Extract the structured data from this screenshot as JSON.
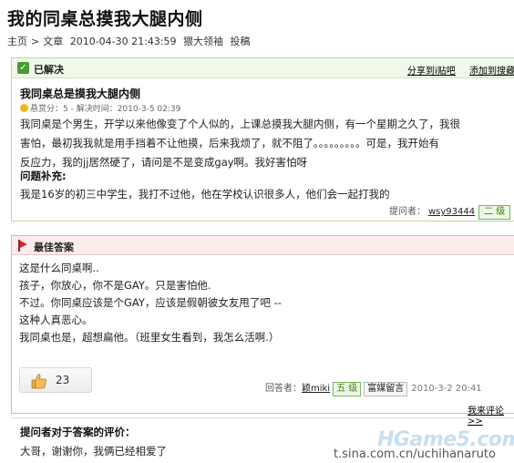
{
  "page": {
    "title": "我的同桌总摸我大腿内侧",
    "meta": {
      "breadcrumb_home": "主页",
      "breadcrumb_sep": ">",
      "breadcrumb_article": "文章",
      "timestamp": "2010-04-30 21:43:59",
      "author": "猥大领袖",
      "action": "投稿"
    }
  },
  "question": {
    "status_icon": "check-icon",
    "status": "已解决",
    "share_label": "分享到i贴吧",
    "fav_label": "添加到搜藏",
    "title": "我同桌总是摸我大腿内侧",
    "reward": "悬赏分：5 - 解决时间：2010-3-5 02:39",
    "body_lines": [
      "我同桌是个男生，开学以来他像变了个人似的，上课总摸我大腿内侧，有一个星期之久了，我很",
      "害怕，最初我我就是用手挡着不让他摸，后来我烦了，就不阻了。。。。。。。。。可是，我开始有",
      "反应力，我的jj居然硬了，请问是不是变成gay啊。我好害怕呀"
    ],
    "supplement_title": "问题补充:",
    "supplement": "我是16岁的初三中学生，我打不过他，他在学校认识很多人，他们会一起打我的",
    "asker_label": "提问者：",
    "asker_name": "wsy93444",
    "asker_level": "二 级"
  },
  "answer": {
    "header_icon": "flag-icon",
    "header": "最佳答案",
    "lines": [
      "这是什么同桌啊..",
      "孩子，你放心，你不是GAY。只是害怕他.",
      "不过。你同桌应该是个GAY，应该是假朝彼女友甩了吧 --",
      "这种人真恶心。",
      "我同桌也是，超想扁他。（班里女生看到，我怎么活啊.）"
    ],
    "like_count": "23",
    "answerer_label": "回答者：",
    "answerer_name": "颖miki",
    "answerer_level": "五 级",
    "message_label": "富媒留言",
    "date": "2010-3-2 20:41",
    "comment_link": "我来评论>>"
  },
  "evaluation": {
    "title": "提问者对于答案的评价：",
    "body": "大哥，谢谢你，我俩已经相爱了"
  },
  "watermark": {
    "logo": "HGame5.com",
    "source": "t.sina.com.cn/uchihanaruto"
  },
  "colors": {
    "solved_green": "#4a9a2e",
    "best_answer_red": "#d02a2a",
    "coin_gold": "#f1b61c"
  }
}
